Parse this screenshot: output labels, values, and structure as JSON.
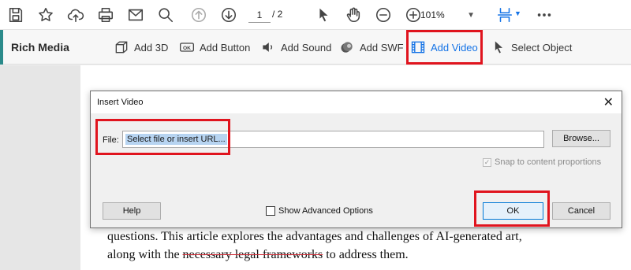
{
  "toolbar": {
    "page_current": "1",
    "page_total": "/ 2",
    "zoom": "101%",
    "icons": [
      "save-icon",
      "bookmark-star-icon",
      "upload-cloud-icon",
      "print-icon",
      "email-icon",
      "zoom-search-icon",
      "page-up-icon",
      "page-down-icon",
      "select-arrow-icon",
      "hand-icon",
      "zoom-out-icon",
      "zoom-in-icon",
      "page-layout-icon",
      "more-icon"
    ]
  },
  "rich_media": {
    "title": "Rich Media",
    "items": [
      {
        "label": "Add 3D",
        "icon": "cube-icon"
      },
      {
        "label": "Add Button",
        "icon": "ok-button-icon"
      },
      {
        "label": "Add Sound",
        "icon": "speaker-icon"
      },
      {
        "label": "Add SWF",
        "icon": "swf-icon"
      },
      {
        "label": "Add Video",
        "icon": "film-icon",
        "active": true
      },
      {
        "label": "Select Object",
        "icon": "pointer-icon"
      }
    ],
    "active_color": "#1473e6",
    "accent_color": "#2b8a8a"
  },
  "dialog": {
    "title": "Insert Video",
    "close": "✕",
    "file_label": "File:",
    "file_placeholder": "Select file or insert URL...",
    "browse_label": "Browse...",
    "snap_label": "Snap to content proportions",
    "snap_checked": true,
    "help_label": "Help",
    "advanced_label": "Show Advanced Options",
    "advanced_checked": false,
    "ok_label": "OK",
    "cancel_label": "Cancel"
  },
  "document": {
    "line1": "questions. This article explores the advantages and challenges of AI-generated art,",
    "line2_before": "along with the ",
    "line2_strike": "necessary legal frameworks",
    "line2_after": " to address them."
  },
  "highlight_color": "#e0141e"
}
